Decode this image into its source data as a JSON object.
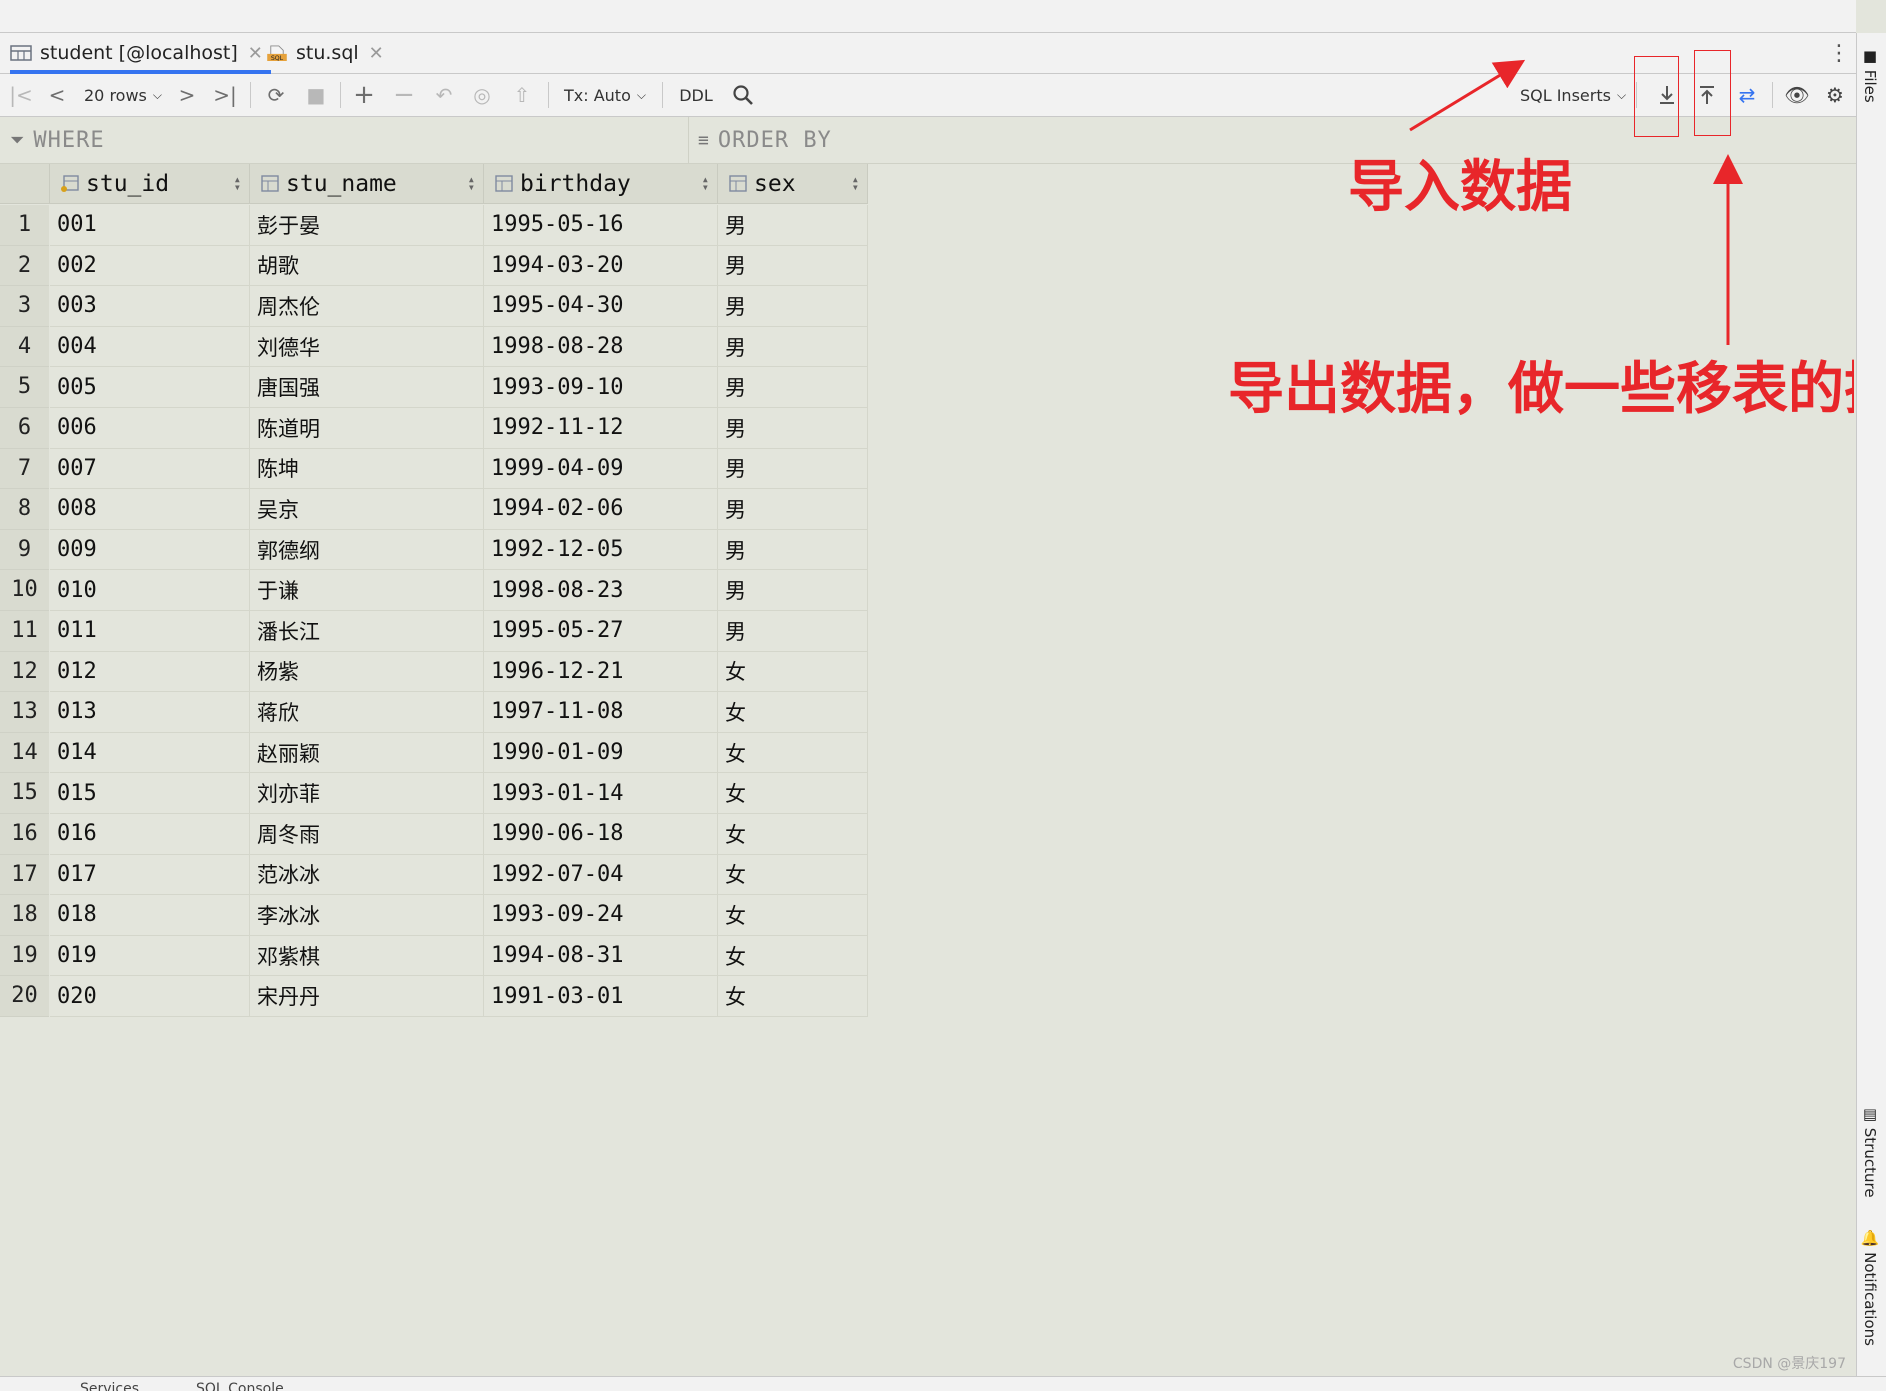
{
  "tabs": [
    {
      "label": "student [@localhost]",
      "icon": "table-icon",
      "active": true
    },
    {
      "label": "stu.sql",
      "icon": "sql-file-icon",
      "active": false
    }
  ],
  "toolbar": {
    "rows_label": "20 rows",
    "tx_label": "Tx: Auto",
    "ddl_label": "DDL",
    "format_label": "SQL Inserts"
  },
  "filter": {
    "where_label": "WHERE",
    "order_label": "ORDER BY"
  },
  "columns": [
    "stu_id",
    "stu_name",
    "birthday",
    "sex"
  ],
  "rows": [
    {
      "num": "1",
      "stu_id": "001",
      "stu_name": "彭于晏",
      "birthday": "1995-05-16",
      "sex": "男"
    },
    {
      "num": "2",
      "stu_id": "002",
      "stu_name": "胡歌",
      "birthday": "1994-03-20",
      "sex": "男"
    },
    {
      "num": "3",
      "stu_id": "003",
      "stu_name": "周杰伦",
      "birthday": "1995-04-30",
      "sex": "男"
    },
    {
      "num": "4",
      "stu_id": "004",
      "stu_name": "刘德华",
      "birthday": "1998-08-28",
      "sex": "男"
    },
    {
      "num": "5",
      "stu_id": "005",
      "stu_name": "唐国强",
      "birthday": "1993-09-10",
      "sex": "男"
    },
    {
      "num": "6",
      "stu_id": "006",
      "stu_name": "陈道明",
      "birthday": "1992-11-12",
      "sex": "男"
    },
    {
      "num": "7",
      "stu_id": "007",
      "stu_name": "陈坤",
      "birthday": "1999-04-09",
      "sex": "男"
    },
    {
      "num": "8",
      "stu_id": "008",
      "stu_name": "吴京",
      "birthday": "1994-02-06",
      "sex": "男"
    },
    {
      "num": "9",
      "stu_id": "009",
      "stu_name": "郭德纲",
      "birthday": "1992-12-05",
      "sex": "男"
    },
    {
      "num": "10",
      "stu_id": "010",
      "stu_name": "于谦",
      "birthday": "1998-08-23",
      "sex": "男"
    },
    {
      "num": "11",
      "stu_id": "011",
      "stu_name": "潘长江",
      "birthday": "1995-05-27",
      "sex": "男"
    },
    {
      "num": "12",
      "stu_id": "012",
      "stu_name": "杨紫",
      "birthday": "1996-12-21",
      "sex": "女"
    },
    {
      "num": "13",
      "stu_id": "013",
      "stu_name": "蒋欣",
      "birthday": "1997-11-08",
      "sex": "女"
    },
    {
      "num": "14",
      "stu_id": "014",
      "stu_name": "赵丽颖",
      "birthday": "1990-01-09",
      "sex": "女"
    },
    {
      "num": "15",
      "stu_id": "015",
      "stu_name": "刘亦菲",
      "birthday": "1993-01-14",
      "sex": "女"
    },
    {
      "num": "16",
      "stu_id": "016",
      "stu_name": "周冬雨",
      "birthday": "1990-06-18",
      "sex": "女"
    },
    {
      "num": "17",
      "stu_id": "017",
      "stu_name": "范冰冰",
      "birthday": "1992-07-04",
      "sex": "女"
    },
    {
      "num": "18",
      "stu_id": "018",
      "stu_name": "李冰冰",
      "birthday": "1993-09-24",
      "sex": "女"
    },
    {
      "num": "19",
      "stu_id": "019",
      "stu_name": "邓紫棋",
      "birthday": "1994-08-31",
      "sex": "女"
    },
    {
      "num": "20",
      "stu_id": "020",
      "stu_name": "宋丹丹",
      "birthday": "1991-03-01",
      "sex": "女"
    }
  ],
  "annotations": {
    "import_label": "导入数据",
    "export_label": "导出数据，做一些移表的操"
  },
  "sidebar": {
    "files": "Files",
    "structure": "Structure",
    "notifications": "Notifications"
  },
  "bottom": {
    "services": "Services",
    "sql_console": "SQL Console"
  },
  "watermark": "CSDN @景庆197",
  "colors": {
    "accent": "#3574f0",
    "annotation": "#e8262a",
    "grid_bg": "#e3e5dc",
    "header_bg": "#d9dbd0"
  }
}
